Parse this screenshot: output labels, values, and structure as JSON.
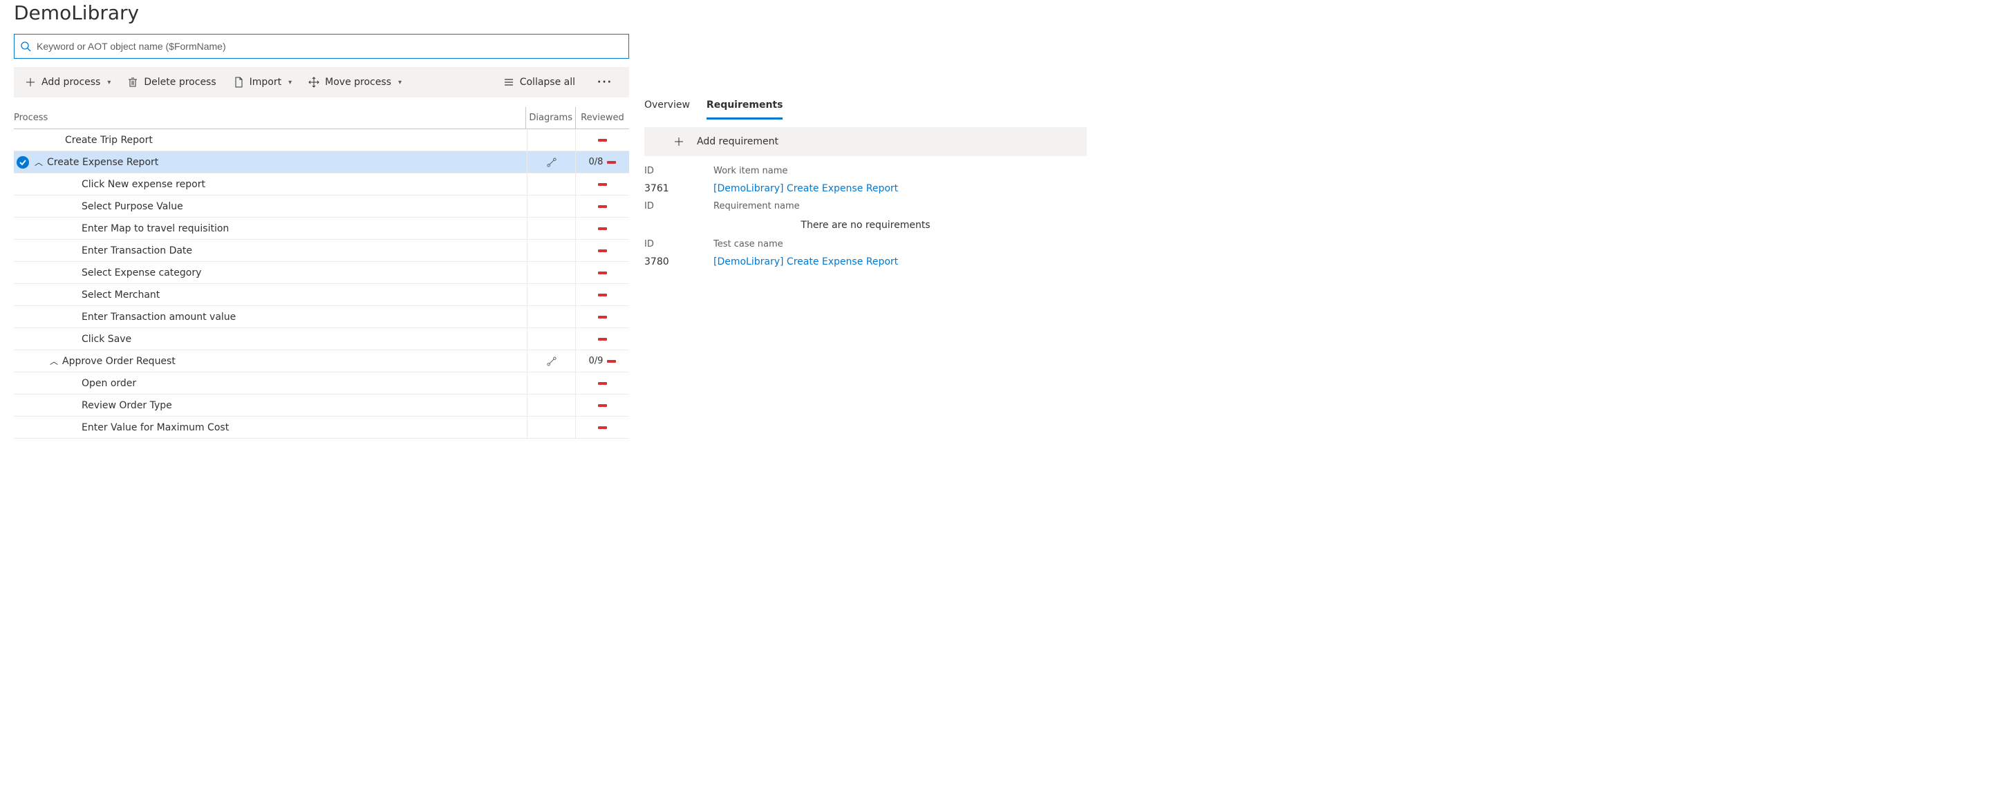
{
  "page_title": "DemoLibrary",
  "search": {
    "placeholder": "Keyword or AOT object name ($FormName)"
  },
  "toolbar": {
    "add_process": "Add process",
    "delete_process": "Delete process",
    "import_label": "Import",
    "move_process": "Move process",
    "collapse_all": "Collapse all"
  },
  "columns": {
    "process": "Process",
    "diagrams": "Diagrams",
    "reviewed": "Reviewed"
  },
  "rows": [
    {
      "label": "Create Trip Report",
      "indent": 1,
      "parent": false,
      "selected": false,
      "diagram": false,
      "reviewed": ""
    },
    {
      "label": "Create Expense Report",
      "indent": 1,
      "parent": true,
      "selected": true,
      "diagram": true,
      "reviewed": "0/8"
    },
    {
      "label": "Click New expense report",
      "indent": 2,
      "parent": false,
      "selected": false,
      "diagram": false,
      "reviewed": ""
    },
    {
      "label": "Select Purpose Value",
      "indent": 2,
      "parent": false,
      "selected": false,
      "diagram": false,
      "reviewed": ""
    },
    {
      "label": "Enter Map to travel requisition",
      "indent": 2,
      "parent": false,
      "selected": false,
      "diagram": false,
      "reviewed": ""
    },
    {
      "label": "Enter Transaction Date",
      "indent": 2,
      "parent": false,
      "selected": false,
      "diagram": false,
      "reviewed": ""
    },
    {
      "label": "Select Expense category",
      "indent": 2,
      "parent": false,
      "selected": false,
      "diagram": false,
      "reviewed": ""
    },
    {
      "label": "Select Merchant",
      "indent": 2,
      "parent": false,
      "selected": false,
      "diagram": false,
      "reviewed": ""
    },
    {
      "label": "Enter Transaction amount value",
      "indent": 2,
      "parent": false,
      "selected": false,
      "diagram": false,
      "reviewed": ""
    },
    {
      "label": "Click Save",
      "indent": 2,
      "parent": false,
      "selected": false,
      "diagram": false,
      "reviewed": ""
    },
    {
      "label": "Approve Order Request",
      "indent": 1,
      "parent": true,
      "selected": false,
      "diagram": true,
      "reviewed": "0/9"
    },
    {
      "label": "Open order",
      "indent": 2,
      "parent": false,
      "selected": false,
      "diagram": false,
      "reviewed": ""
    },
    {
      "label": "Review Order Type",
      "indent": 2,
      "parent": false,
      "selected": false,
      "diagram": false,
      "reviewed": ""
    },
    {
      "label": "Enter Value for Maximum Cost",
      "indent": 2,
      "parent": false,
      "selected": false,
      "diagram": false,
      "reviewed": ""
    }
  ],
  "tabs": {
    "overview": "Overview",
    "requirements": "Requirements",
    "active": "requirements"
  },
  "req_toolbar": {
    "add": "Add requirement"
  },
  "panel": {
    "id_label": "ID",
    "work_item_head": "Work item name",
    "requirement_head": "Requirement name",
    "testcase_head": "Test case name",
    "no_requirements": "There are no requirements",
    "work_item": {
      "id": "3761",
      "name": "[DemoLibrary] Create Expense Report"
    },
    "test_case": {
      "id": "3780",
      "name": "[DemoLibrary] Create Expense Report"
    }
  }
}
